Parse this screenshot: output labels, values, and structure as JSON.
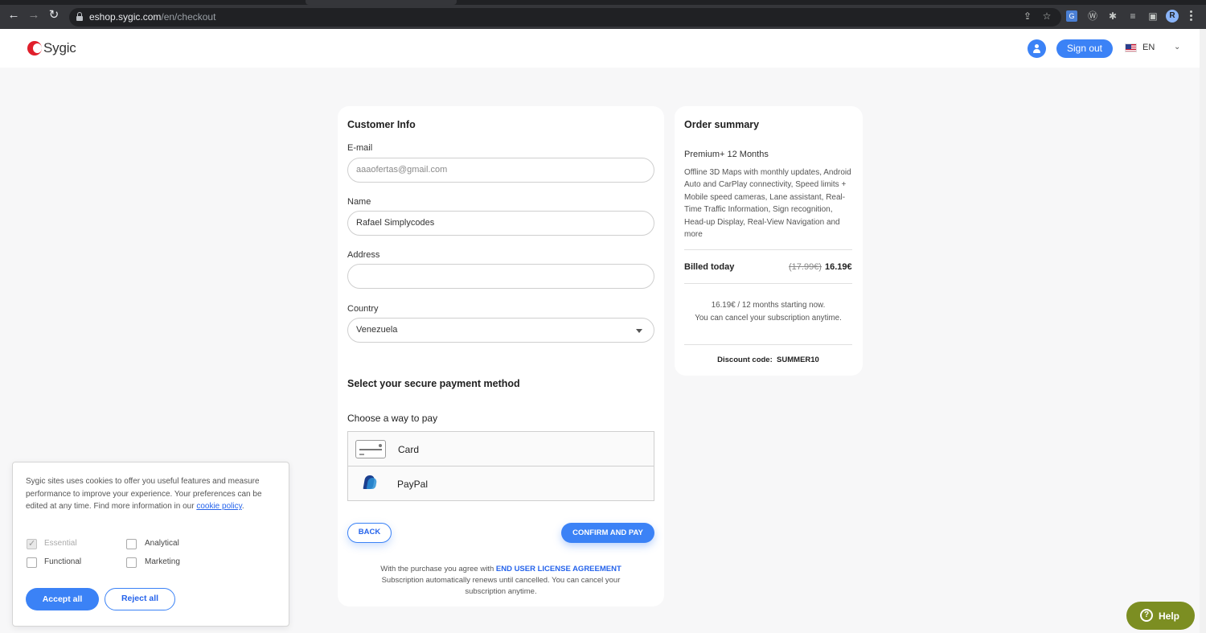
{
  "browser": {
    "url_host": "eshop.sygic.com",
    "url_path": "/en/checkout",
    "profile_initial": "R"
  },
  "header": {
    "logo_text": "Sygic",
    "sign_out_label": "Sign out",
    "language": "EN"
  },
  "customer_info": {
    "title": "Customer Info",
    "email_label": "E-mail",
    "email_value": "aaaofertas@gmail.com",
    "name_label": "Name",
    "name_value": "Rafael Simplycodes",
    "address_label": "Address",
    "address_value": "",
    "country_label": "Country",
    "country_value": "Venezuela"
  },
  "payment": {
    "title": "Select your secure payment method",
    "subtitle": "Choose a way to pay",
    "methods": [
      {
        "label": "Card"
      },
      {
        "label": "PayPal"
      }
    ],
    "back_label": "BACK",
    "confirm_label": "CONFIRM AND PAY",
    "legal_prefix": "With the purchase you agree with",
    "legal_link": "END USER LICENSE AGREEMENT",
    "legal_suffix": "Subscription automatically renews until cancelled. You can cancel your subscription anytime."
  },
  "order_summary": {
    "title": "Order summary",
    "product": "Premium+ 12 Months",
    "description": "Offline 3D Maps with monthly updates, Android Auto and CarPlay connectivity, Speed limits + Mobile speed cameras, Lane assistant, Real-Time Traffic Information, Sign recognition, Head-up Display, Real-View Navigation and more",
    "billed_label": "Billed today",
    "old_price": "(17.99€)",
    "new_price": "16.19€",
    "note_line1": "16.19€ / 12 months starting now.",
    "note_line2": "You can cancel your subscription anytime.",
    "discount_label": "Discount code:",
    "discount_code": "SUMMER10"
  },
  "cookie_banner": {
    "text": "Sygic sites uses cookies to offer you useful features and measure performance to improve your experience. Your preferences can be edited at any time. Find more information in our",
    "link": "cookie policy",
    "text_end": ".",
    "options": {
      "essential": "Essential",
      "analytical": "Analytical",
      "functional": "Functional",
      "marketing": "Marketing"
    },
    "accept_label": "Accept all",
    "reject_label": "Reject all"
  },
  "help": {
    "label": "Help"
  },
  "colors": {
    "accent": "#3b82f6",
    "brand_red": "#e01f2b",
    "help_green": "#7c8e22"
  }
}
